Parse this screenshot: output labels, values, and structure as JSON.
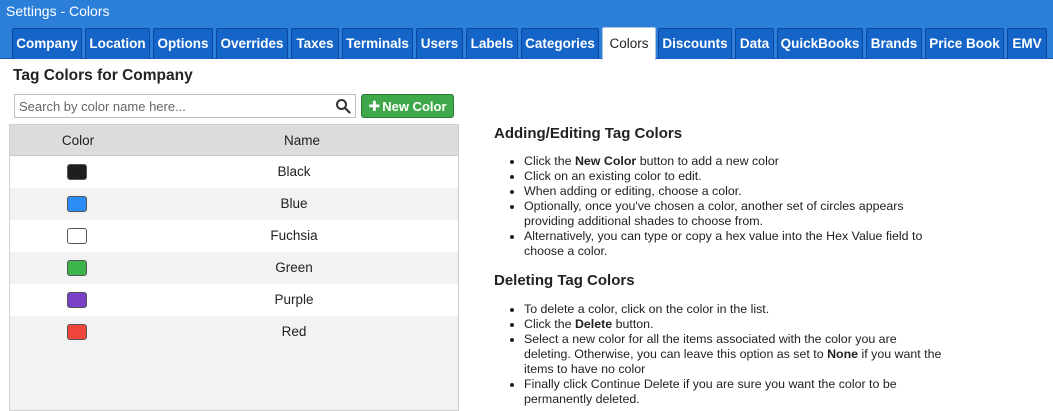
{
  "window": {
    "title": "Settings - Colors"
  },
  "tabs": [
    {
      "label": "Company"
    },
    {
      "label": "Location"
    },
    {
      "label": "Options"
    },
    {
      "label": "Overrides"
    },
    {
      "label": "Taxes"
    },
    {
      "label": "Terminals"
    },
    {
      "label": "Users"
    },
    {
      "label": "Labels"
    },
    {
      "label": "Categories"
    },
    {
      "label": "Colors",
      "active": true
    },
    {
      "label": "Discounts"
    },
    {
      "label": "Data"
    },
    {
      "label": "QuickBooks"
    },
    {
      "label": "Brands"
    },
    {
      "label": "Price Book"
    },
    {
      "label": "EMV"
    }
  ],
  "main": {
    "title": "Tag Colors for Company",
    "search": {
      "placeholder": "Search by color name here...",
      "value": "",
      "icon": "search-icon"
    },
    "new_button": {
      "label": "New Color",
      "icon": "plus-icon",
      "color": "#3fa84a"
    },
    "table": {
      "headers": {
        "color": "Color",
        "name": "Name"
      },
      "rows": [
        {
          "name": "Black",
          "color": "#1e1e1e"
        },
        {
          "name": "Blue",
          "color": "#2a8df5"
        },
        {
          "name": "Fuchsia",
          "color": "#ffffff"
        },
        {
          "name": "Green",
          "color": "#3cb44b"
        },
        {
          "name": "Purple",
          "color": "#7a3fc7"
        },
        {
          "name": "Red",
          "color": "#f0453a"
        }
      ]
    }
  },
  "help": {
    "adding": {
      "title": "Adding/Editing Tag Colors",
      "items": [
        [
          "Click the ",
          "New Color",
          " button to add a new color"
        ],
        [
          "Click on an existing color to edit."
        ],
        [
          "When adding or editing, choose a color."
        ],
        [
          "Optionally, once you've chosen a color, another set of circles appears providing additional shades to choose from."
        ],
        [
          "Alternatively, you can type or copy a hex value into the Hex Value field to choose a color."
        ]
      ]
    },
    "deleting": {
      "title": "Deleting Tag Colors",
      "items": [
        [
          "To delete a color, click on the color in the list."
        ],
        [
          "Click the ",
          "Delete",
          " button."
        ],
        [
          "Select a new color for all the items associated with the color you are deleting. Otherwise, you can leave this option as set to ",
          "None",
          " if you want the items to have no color"
        ],
        [
          "Finally click Continue Delete if you are sure you want the color to be permanently deleted."
        ]
      ]
    }
  },
  "colors": {
    "title_bar": "#2b7fd8",
    "tab": "#1565c8",
    "tab_active": "#ffffff"
  }
}
